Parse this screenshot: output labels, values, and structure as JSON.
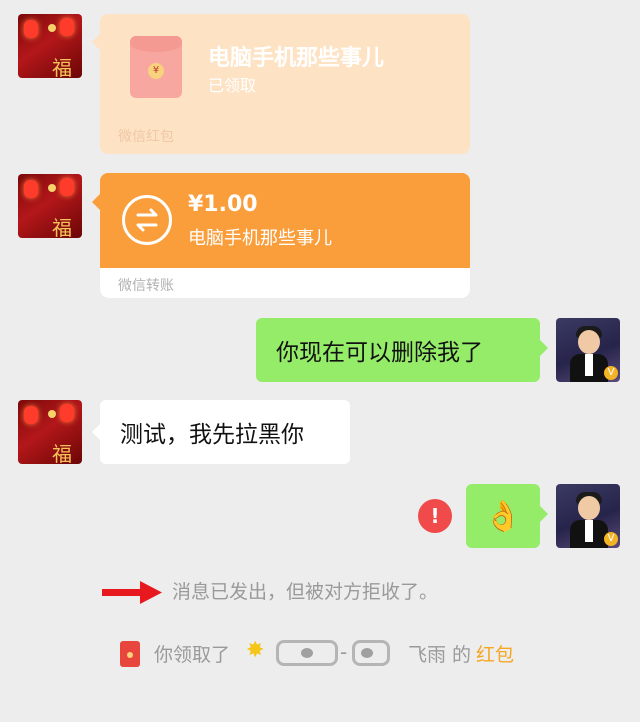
{
  "messages": {
    "red_packet": {
      "sender_name": "电脑手机那些事儿",
      "status": "已领取",
      "footer": "微信红包",
      "envelope_symbol": "¥"
    },
    "transfer": {
      "amount": "¥1.00",
      "note": "电脑手机那些事儿",
      "footer": "微信转账"
    },
    "sent_text": "你现在可以删除我了",
    "received_text": "测试，我先拉黑你",
    "sent_emoji": "👌",
    "error_icon": "!",
    "avatar_fu": "福",
    "avatar_badge": "V"
  },
  "system": {
    "rejected": "消息已发出，但被对方拒收了。",
    "claimed_prefix": "你领取了",
    "claimed_name": "飞雨",
    "claimed_suffix": "的",
    "claimed_link": "红包"
  },
  "colors": {
    "background": "#ededed",
    "green_bubble": "#95ec69",
    "transfer_orange": "#fa9d3b",
    "red_packet_faded": "#fde2c4",
    "error_red": "#f04a4a",
    "arrow_red": "#e8191e",
    "link_orange": "#f5a623"
  }
}
